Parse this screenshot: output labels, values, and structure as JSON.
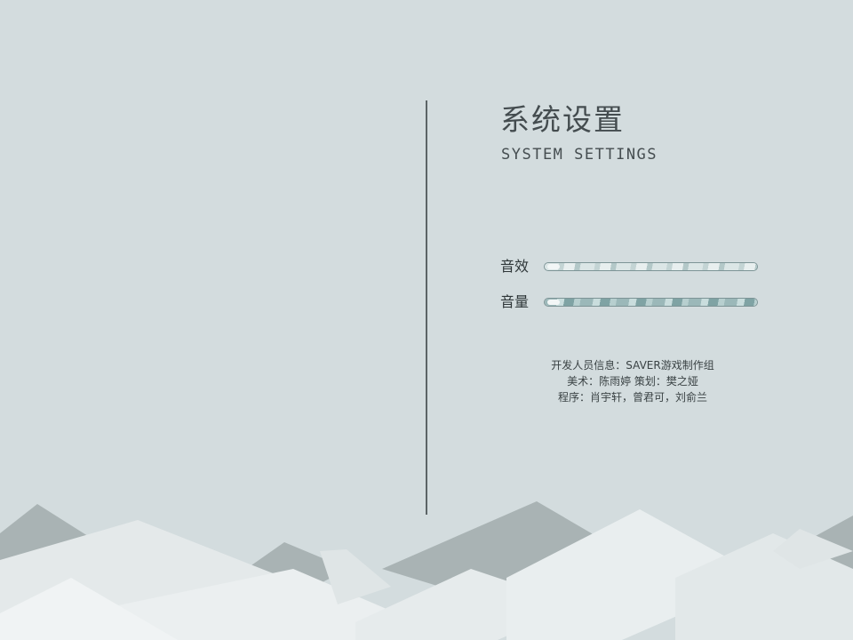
{
  "settings": {
    "title_cn": "系统设置",
    "title_en": "SYSTEM SETTINGS",
    "sound_effect_label": "音效",
    "volume_label": "音量",
    "sound_effect_level": 1.0,
    "volume_level": 1.0
  },
  "credits": {
    "line1": "开发人员信息：SAVER游戏制作组",
    "line2": "美术：陈雨婷  策划：樊之娅",
    "line3": "程序：肖宇轩，曾君可，刘俞兰"
  },
  "colors": {
    "background": "#d3dcde",
    "divider": "#5c6466",
    "mountain_dark": "#aab4b5",
    "mountain_light": "#e9eeef"
  }
}
